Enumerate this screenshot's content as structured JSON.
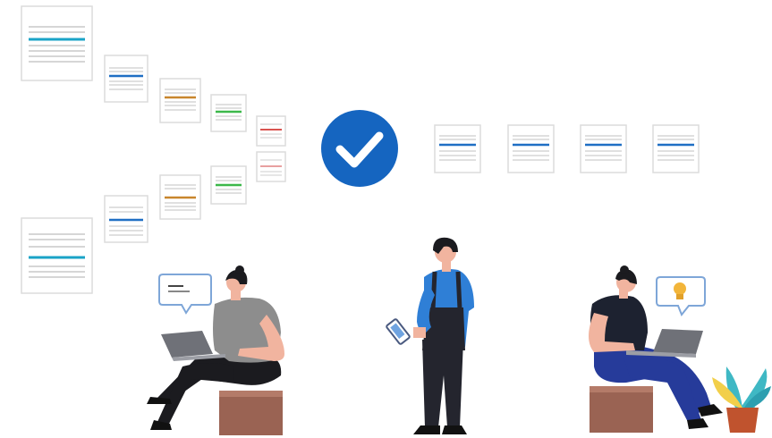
{
  "illustration": {
    "colors": {
      "check_badge": "#1565c0",
      "doc_blue": "#1f6fc4",
      "doc_teal": "#1aa3c7",
      "doc_orange": "#c8862c",
      "doc_green": "#3cb84a",
      "doc_red": "#d9534f",
      "doc_pink": "#e8a0a0",
      "shirt_blue": "#2f7fd6",
      "overalls": "#24252e",
      "shirt_gray": "#8d8d8d",
      "pants_black": "#1b1b1f",
      "shirt_dark": "#1d2230",
      "pants_navy": "#263b9a",
      "stool": "#9a6353",
      "skin": "#f1b49f",
      "plant_teal": "#3fb8c4",
      "plant_yellow": "#f2cf4a",
      "pot": "#c0532e"
    },
    "icons": [
      "check-icon",
      "chat-bubble-icon",
      "lightbulb-icon",
      "smartphone-icon",
      "laptop-icon"
    ]
  }
}
